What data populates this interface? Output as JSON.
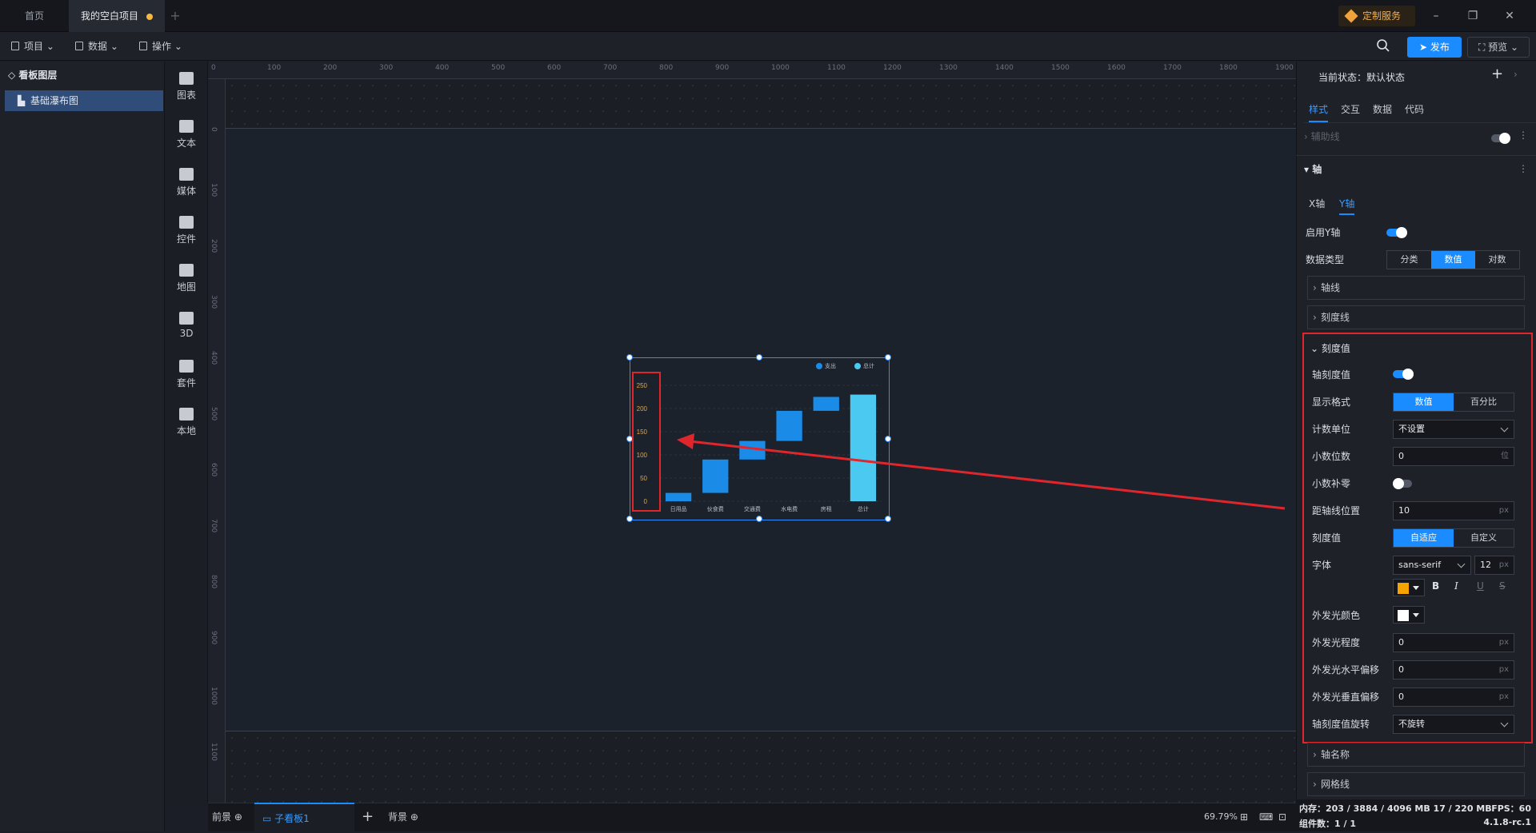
{
  "titlebar": {
    "tabs": [
      {
        "label": "首页"
      },
      {
        "label": "我的空白项目"
      }
    ],
    "custom_service": "定制服务"
  },
  "menubar": {
    "items": [
      {
        "label": "项目"
      },
      {
        "label": "数据"
      },
      {
        "label": "操作"
      }
    ],
    "publish": "发布",
    "preview": "预览"
  },
  "layers": {
    "title": "看板图层",
    "items": [
      {
        "label": "基础瀑布图"
      }
    ]
  },
  "toolbar": {
    "items": [
      {
        "label": "图表",
        "icon": "bar-chart-icon"
      },
      {
        "label": "文本",
        "icon": "text-icon"
      },
      {
        "label": "媒体",
        "icon": "media-icon"
      },
      {
        "label": "控件",
        "icon": "control-icon"
      },
      {
        "label": "地图",
        "icon": "map-icon"
      },
      {
        "label": "3D",
        "icon": "cube-icon"
      },
      {
        "label": "套件",
        "icon": "kit-icon"
      },
      {
        "label": "本地",
        "icon": "puzzle-icon"
      }
    ]
  },
  "ruler": {
    "h_ticks": [
      "0",
      "100",
      "200",
      "300",
      "400",
      "500",
      "600",
      "700",
      "800",
      "900",
      "1000",
      "1100",
      "1200",
      "1300",
      "1400",
      "1500",
      "1600",
      "1700",
      "1800",
      "1900"
    ],
    "v_ticks": [
      "0",
      "100",
      "200",
      "300",
      "400",
      "500",
      "600",
      "700",
      "800",
      "900",
      "1000",
      "1100"
    ]
  },
  "chart_data": {
    "type": "bar",
    "subtype": "waterfall",
    "categories": [
      "日用品",
      "伙食费",
      "交通费",
      "水电费",
      "房租",
      "总计"
    ],
    "legend": [
      "支出",
      "总计"
    ],
    "ylim": [
      0,
      250
    ],
    "yticks": [
      "0",
      "50",
      "100",
      "150",
      "200",
      "250"
    ],
    "series": [
      {
        "name": "支出",
        "base": [
          0,
          18,
          90,
          130,
          195,
          0
        ],
        "values": [
          18,
          72,
          40,
          65,
          30,
          0
        ],
        "color": "#1a8ce8"
      },
      {
        "name": "总计",
        "base": [
          0,
          0,
          0,
          0,
          0,
          0
        ],
        "values": [
          0,
          0,
          0,
          0,
          0,
          230
        ],
        "color": "#4cc9f0"
      }
    ],
    "ytick_color": "#e8a33a"
  },
  "bottombar": {
    "front": "前景",
    "subboard": "子看板1",
    "background": "背景",
    "zoom": "69.79%"
  },
  "status": {
    "memory": "内存：203 / 3884 / 4096 MB 17 / 220 MB",
    "fps": "FPS：60",
    "components": "组件数：1 / 1",
    "version": "4.1.8-rc.1"
  },
  "rpanel": {
    "state": "当前状态：默认状态",
    "tabs": [
      "样式",
      "交互",
      "数据",
      "代码"
    ],
    "guide": "辅助线",
    "axis_section": "轴",
    "axis_tabs": [
      "X轴",
      "Y轴"
    ],
    "enable_y": "启用Y轴",
    "data_type_label": "数据类型",
    "data_types": [
      "分类",
      "数值",
      "对数"
    ],
    "axis_line": "轴线",
    "tick_line": "刻度线",
    "tick_value": "刻度值",
    "axis_tick_value": "轴刻度值",
    "display_format_label": "显示格式",
    "display_formats": [
      "数值",
      "百分比"
    ],
    "count_unit_label": "计数单位",
    "count_unit": "不设置",
    "decimals_label": "小数位数",
    "decimals": "0",
    "decimals_unit": "位",
    "zero_pad_label": "小数补零",
    "offset_label": "距轴线位置",
    "offset": "10",
    "tick_mode_label": "刻度值",
    "tick_modes": [
      "自适应",
      "自定义"
    ],
    "font_label": "字体",
    "font_family": "sans-serif",
    "font_size": "12",
    "font_color": "#f5a300",
    "glow_color_label": "外发光颜色",
    "glow_color": "#ffffff",
    "glow_level_label": "外发光程度",
    "glow_level": "0",
    "glow_h_label": "外发光水平偏移",
    "glow_h": "0",
    "glow_v_label": "外发光垂直偏移",
    "glow_v": "0",
    "rotate_label": "轴刻度值旋转",
    "rotate": "不旋转",
    "axis_name": "轴名称",
    "grid_line": "网格线",
    "px": "px"
  }
}
